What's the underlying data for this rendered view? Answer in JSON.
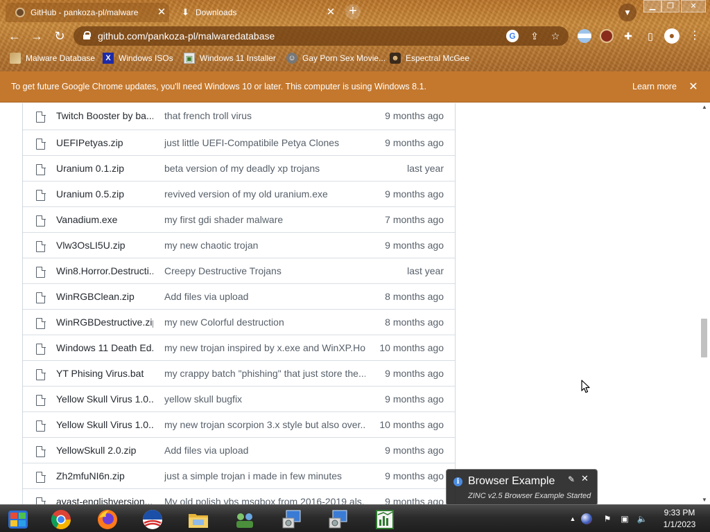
{
  "tabs": [
    {
      "label": "GitHub - pankoza-pl/malwaredatabase",
      "icon": "github-icon"
    },
    {
      "label": "Downloads",
      "icon": "download-icon"
    }
  ],
  "toolbar": {
    "url": "github.com/pankoza-pl/malwaredatabase"
  },
  "bookmarks": [
    {
      "label": "Malware Database"
    },
    {
      "label": "Windows ISOs"
    },
    {
      "label": "Windows 11 Installer"
    },
    {
      "label": "Gay Porn Sex Movie..."
    },
    {
      "label": "Espectral McGee"
    }
  ],
  "info_bar": {
    "message": "To get future Google Chrome updates, you'll need Windows 10 or later. This computer is using Windows 8.1.",
    "learn_more": "Learn more"
  },
  "files": [
    {
      "name": "Twitch Booster by ba...",
      "message": "that french troll virus",
      "age": "9 months ago"
    },
    {
      "name": "UEFIPetyas.zip",
      "message": "just little UEFI-Compatibile Petya Clones",
      "age": "9 months ago"
    },
    {
      "name": "Uranium 0.1.zip",
      "message": "beta version of my deadly xp trojans",
      "age": "last year"
    },
    {
      "name": "Uranium 0.5.zip",
      "message": "revived version of my old uranium.exe",
      "age": "9 months ago"
    },
    {
      "name": "Vanadium.exe",
      "message": "my first gdi shader malware",
      "age": "7 months ago"
    },
    {
      "name": "Vlw3OsLI5U.zip",
      "message": "my new chaotic trojan",
      "age": "9 months ago"
    },
    {
      "name": "Win8.Horror.Destructi...",
      "message": "Creepy Destructive Trojans",
      "age": "last year"
    },
    {
      "name": "WinRGBClean.zip",
      "message": "Add files via upload",
      "age": "8 months ago"
    },
    {
      "name": "WinRGBDestructive.zip",
      "message": "my new Colorful destruction",
      "age": "8 months ago"
    },
    {
      "name": "Windows 11 Death Ed...",
      "message": "my new trojan inspired by x.exe and WinXP.Ho...",
      "age": "10 months ago"
    },
    {
      "name": "YT Phising Virus.bat",
      "message": "my crappy batch \"phishing\" that just store the...",
      "age": "9 months ago"
    },
    {
      "name": "Yellow Skull Virus 1.0....",
      "message": "yellow skull bugfix",
      "age": "9 months ago"
    },
    {
      "name": "Yellow Skull Virus 1.0....",
      "message": "my new trojan scorpion 3.x style but also over...",
      "age": "10 months ago"
    },
    {
      "name": "YellowSkull 2.0.zip",
      "message": "Add files via upload",
      "age": "9 months ago"
    },
    {
      "name": "Zh2mfuNI6n.zip",
      "message": "just a simple trojan i made in few minutes",
      "age": "9 months ago"
    },
    {
      "name": "avast-englishversion...",
      "message": "My old polish vbs msgbox from 2016-2019 als...",
      "age": "9 months ago"
    }
  ],
  "scroll": {
    "position": 0.6,
    "visible_fraction": 0.1
  },
  "notification": {
    "title": "Browser Example",
    "body": "ZINC v2.5 Browser Example Started"
  },
  "taskbar": {
    "apps": [
      "start-button",
      "chrome",
      "firefox",
      "obama-app",
      "file-explorer",
      "network-app",
      "setup-1",
      "setup-2",
      "spreadsheet"
    ],
    "time": "9:33 PM",
    "date": "1/1/2023"
  },
  "colors": {
    "theme_brown": "#b9742a",
    "info_bar": "#c4782d",
    "taskbar": "#2b2b2b"
  }
}
